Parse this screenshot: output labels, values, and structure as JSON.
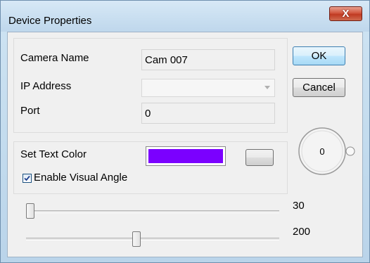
{
  "window": {
    "title": "Device Properties",
    "close_glyph": "X"
  },
  "camera": {
    "name_label": "Camera Name",
    "name_value": "Cam 007",
    "ip_label": "IP Address",
    "ip_value": "",
    "port_label": "Port",
    "port_value": "0"
  },
  "text_color": {
    "label": "Set Text Color",
    "color": "#7b00ff"
  },
  "visual_angle": {
    "label": "Enable Visual Angle",
    "checked": true
  },
  "buttons": {
    "ok": "OK",
    "cancel": "Cancel"
  },
  "dial": {
    "value": "0"
  },
  "sliders": [
    {
      "value": "30",
      "level_fraction": 0.0
    },
    {
      "value": "200",
      "level_fraction": 0.44
    }
  ],
  "icons": {
    "close": "close-icon",
    "check": "checkmark-icon",
    "dropdown": "chevron-down-icon"
  }
}
